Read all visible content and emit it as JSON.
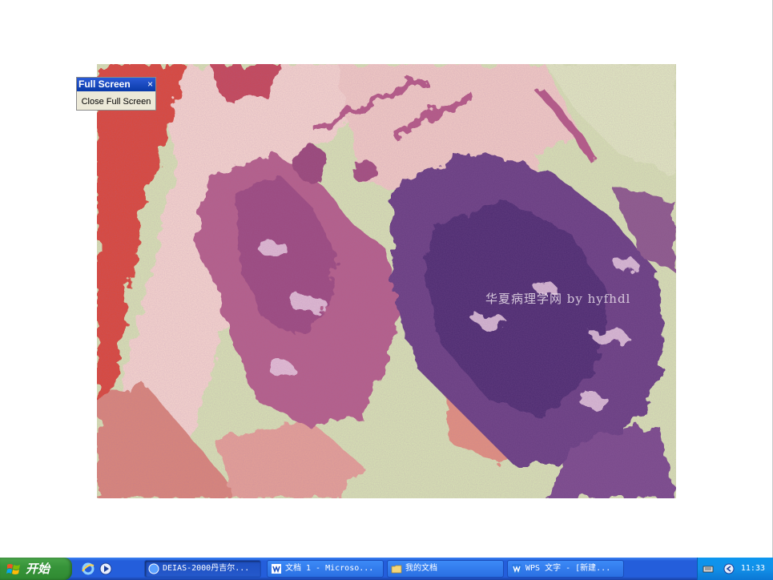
{
  "fullscreen_toolbar": {
    "title": "Full Screen",
    "close_glyph": "×",
    "button_label": "Close Full Screen"
  },
  "image": {
    "description_icon": "microscope-photo",
    "watermark": "华夏病理学网 by hyfhdl"
  },
  "taskbar": {
    "start_label": "开始",
    "quick_launch": [
      "ie-icon",
      "media-player-icon"
    ],
    "tasks": [
      {
        "label": "DEIAS-2000丹吉尔...",
        "icon": "app-icon",
        "active": true
      },
      {
        "label": "文档 1 - Microso...",
        "icon": "word-icon",
        "active": false
      },
      {
        "label": "我的文档",
        "icon": "folder-icon",
        "active": false
      },
      {
        "label": "WPS 文字 - [新建...",
        "icon": "wps-icon",
        "active": false
      }
    ],
    "tray": {
      "icons": [
        "keyboard-icon",
        "network-icon"
      ],
      "clock": "11:33"
    }
  },
  "colors": {
    "taskbar": "#245edb",
    "start": "#37943a",
    "tray": "#1290e8",
    "tissue_pink": "#c98aa0",
    "tissue_purple": "#5a3c78",
    "background_green": "#d9e3b8"
  }
}
